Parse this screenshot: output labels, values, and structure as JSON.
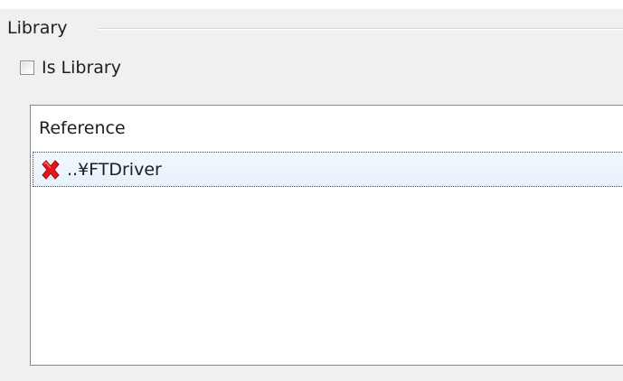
{
  "group": {
    "title": "Library"
  },
  "checkbox": {
    "label": "Is Library",
    "checked": false
  },
  "list": {
    "header": "Reference",
    "items": [
      {
        "label": "..¥FTDriver",
        "icon": "error-icon",
        "icon_color": "#e8141b",
        "selected": true
      }
    ]
  }
}
